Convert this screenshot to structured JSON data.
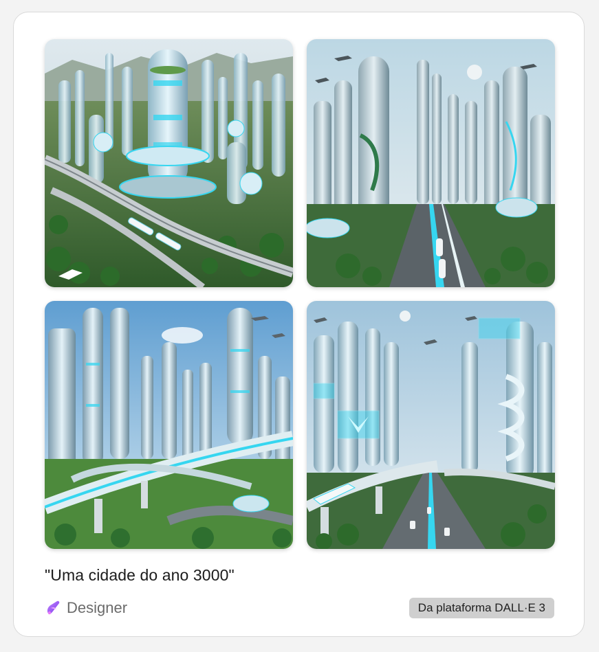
{
  "card": {
    "prompt": "\"Uma cidade do ano 3000\"",
    "brand": {
      "label": "Designer",
      "icon": "designer-logo-icon"
    },
    "source_badge": "Da plataforma DALL·E 3"
  },
  "images": [
    {
      "subject": "futuristic-city-aerial-with-monorail"
    },
    {
      "subject": "futuristic-city-skyscrapers-avenue"
    },
    {
      "subject": "futuristic-city-elevated-highway"
    },
    {
      "subject": "futuristic-city-holographic-train"
    }
  ],
  "colors": {
    "card_bg": "#ffffff",
    "page_bg": "#f3f3f3",
    "badge_bg": "#cfcfcf",
    "brand_text": "#6b6b6b",
    "accent_cyan": "#36d6f0",
    "logo_purple": "#a855f7"
  }
}
